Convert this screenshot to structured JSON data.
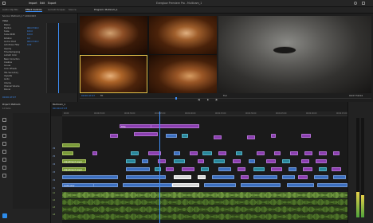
{
  "app": {
    "menu": [
      "Import",
      "Edit",
      "Export"
    ],
    "title": "Everglow Premiere Pro - Multicam_1"
  },
  "workspace": {
    "tabs": [
      "Assembly",
      "Editing",
      "Color",
      "Effects",
      "Audio",
      "Graphics"
    ]
  },
  "effect_controls": {
    "tabs": [
      "Audio Clip Mix",
      "Effect Controls",
      "Lumetri Scopes",
      "Source"
    ],
    "clip_label": "Source: Multicam_1 * A001C003",
    "section_video": "Video",
    "rows": [
      {
        "name": "Motion"
      },
      {
        "name": "Position",
        "value": "960.0  540.0"
      },
      {
        "name": "Scale",
        "value": "100.0"
      },
      {
        "name": "Scale Width",
        "value": "100.0"
      },
      {
        "name": "Rotation",
        "value": "0.0"
      },
      {
        "name": "Anchor Point",
        "value": "960.0  540.0"
      },
      {
        "name": "Anti-flicker Filter",
        "value": "0.00"
      },
      {
        "name": "Opacity"
      },
      {
        "name": "Time Remapping"
      },
      {
        "name": "Lumetri Color"
      },
      {
        "name": "Basic Correction"
      },
      {
        "name": "Creative"
      },
      {
        "name": "Curves"
      },
      {
        "name": "Color Wheels"
      },
      {
        "name": "HSL Secondary"
      },
      {
        "name": "Vignette"
      },
      {
        "name": "Audio"
      },
      {
        "name": "Volume"
      },
      {
        "name": "Channel Volume"
      },
      {
        "name": "Panner"
      }
    ],
    "timecode": "00:00:47:07"
  },
  "program": {
    "label": "Program: Multicam_1",
    "left_timecode": "00:00:47:07",
    "fit": "Fit",
    "quality": "Full",
    "right_timecode": "00:07:59:04",
    "duration": "00:00:15:02"
  },
  "project": {
    "label": "Project: Multicam",
    "item_count": "12 Items"
  },
  "timeline": {
    "sequence_tab": "Multicam_1",
    "timecode": "00:00:47:07",
    "ruler": [
      "00:00",
      "00:00:15:00",
      "00:00:30:00",
      "00:00:45:00",
      "00:01:00:00",
      "00:01:15:00",
      "00:01:30:00",
      "00:01:45:00",
      "00:02:00:00",
      "00:02:15:00"
    ],
    "tracks": [
      "V6",
      "V5",
      "V4",
      "V3",
      "V2",
      "V1",
      "A1",
      "A2",
      "A3",
      "A4"
    ],
    "clip_labels": {
      "adjustment1": "Adjustment Layer",
      "adjustment2": "Adjustment Layer",
      "audio1": "Audio.wav",
      "title": "Title"
    }
  },
  "colors": {
    "video_clip": "#3c6fbf",
    "pink_clip": "#8b3fb0",
    "green_clip": "#7a9a3a",
    "teal_clip": "#29869a",
    "audio_wave": "#6fa33a",
    "playhead": "#3d8df5",
    "accent_blue": "#2d8ceb"
  }
}
